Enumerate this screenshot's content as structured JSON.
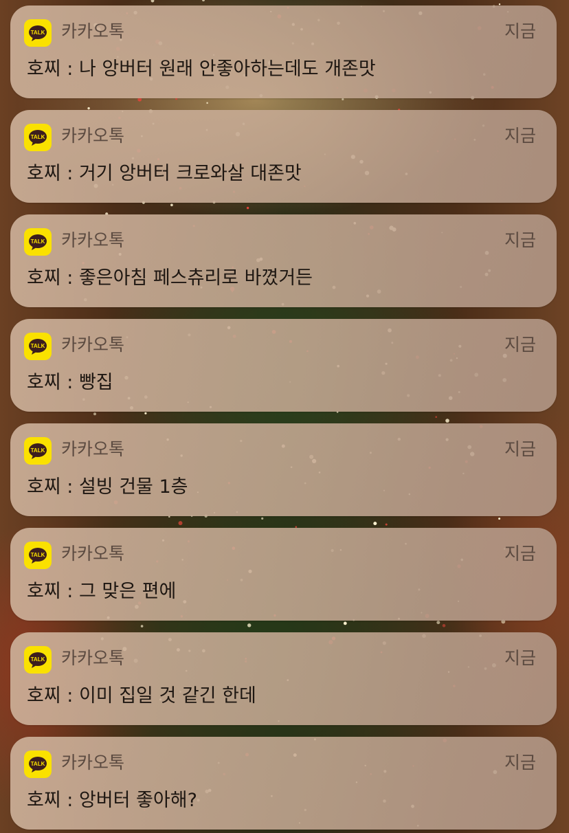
{
  "notifications": [
    {
      "app": "카카오톡",
      "time": "지금",
      "message": "호찌 : 나 앙버터 원래 안좋아하는데도 개존맛",
      "icon": "kakaotalk-talk-icon"
    },
    {
      "app": "카카오톡",
      "time": "지금",
      "message": "호찌 : 거기 앙버터 크로와살 대존맛",
      "icon": "kakaotalk-talk-icon"
    },
    {
      "app": "카카오톡",
      "time": "지금",
      "message": "호찌 : 좋은아침 페스츄리로 바꼈거든",
      "icon": "kakaotalk-talk-icon"
    },
    {
      "app": "카카오톡",
      "time": "지금",
      "message": "호찌 : 빵집",
      "icon": "kakaotalk-talk-icon"
    },
    {
      "app": "카카오톡",
      "time": "지금",
      "message": "호찌 : 설빙 건물 1층",
      "icon": "kakaotalk-talk-icon"
    },
    {
      "app": "카카오톡",
      "time": "지금",
      "message": "호찌 : 그 맞은 편에",
      "icon": "kakaotalk-talk-icon"
    },
    {
      "app": "카카오톡",
      "time": "지금",
      "message": "호찌 : 이미 집일 것 같긴 한데",
      "icon": "kakaotalk-talk-icon"
    },
    {
      "app": "카카오톡",
      "time": "지금",
      "message": "호찌 : 앙버터 좋아해?",
      "icon": "kakaotalk-talk-icon"
    }
  ],
  "icon_logo_text": "TALK",
  "colors": {
    "kakao_yellow": "#fae100",
    "kakao_brown": "#3c1e1e"
  }
}
